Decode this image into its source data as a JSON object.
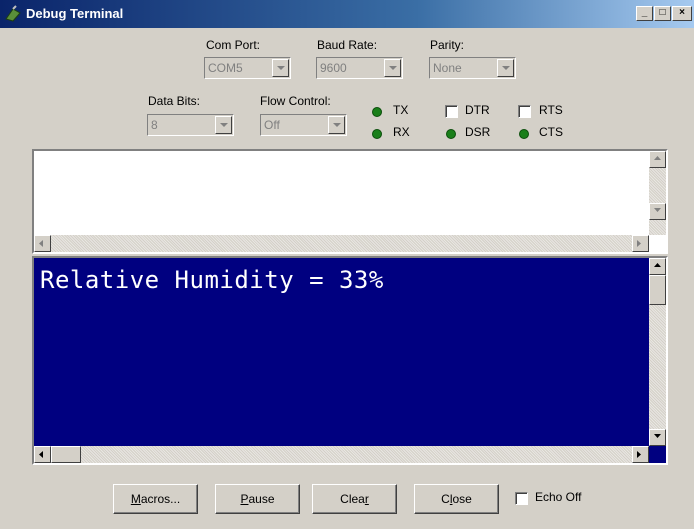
{
  "window": {
    "title": "Debug Terminal",
    "minimize": "_",
    "maximize": "□",
    "close": "×"
  },
  "settings": {
    "com_port": {
      "label": "Com Port:",
      "value": "COM5"
    },
    "baud_rate": {
      "label": "Baud Rate:",
      "value": "9600"
    },
    "parity": {
      "label": "Parity:",
      "value": "None"
    },
    "data_bits": {
      "label": "Data Bits:",
      "value": "8"
    },
    "flow_control": {
      "label": "Flow Control:",
      "value": "Off"
    }
  },
  "indicators": {
    "tx": "TX",
    "rx": "RX",
    "dtr": "DTR",
    "rts": "RTS",
    "dsr": "DSR",
    "cts": "CTS",
    "led_color": "#1a7f1a"
  },
  "transmit_pane": {
    "text": ""
  },
  "receive_pane": {
    "text": "Relative Humidity = 33%",
    "background": "#000080",
    "foreground": "#ffffff"
  },
  "buttons": {
    "macros": {
      "key": "M",
      "rest": "acros..."
    },
    "pause": {
      "key": "P",
      "rest": "ause"
    },
    "clear": {
      "pre": "Clea",
      "key": "r",
      "rest": ""
    },
    "close": {
      "pre": "C",
      "key": "l",
      "rest": "ose"
    },
    "echo_off": "Echo Off"
  }
}
